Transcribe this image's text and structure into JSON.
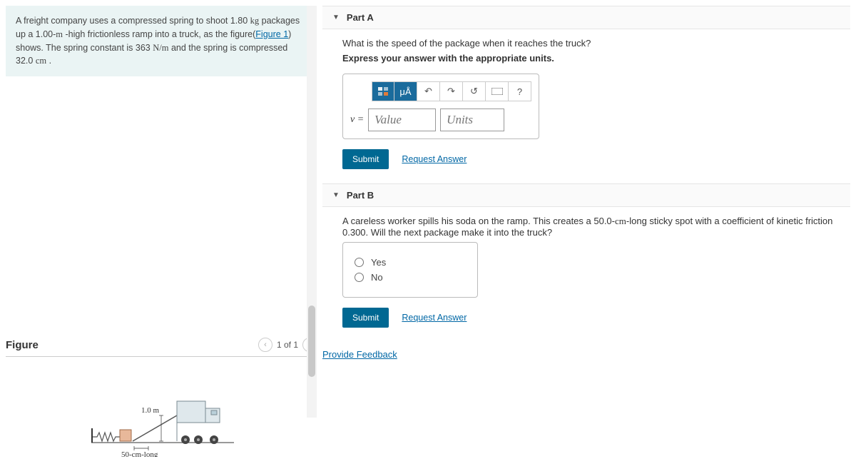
{
  "problem": {
    "text_before_link": "A freight company uses a compressed spring to shoot 1.80 ",
    "unit1": "kg",
    "text2": " packages up a 1.00-",
    "unit2": "m",
    "text3": " -high frictionless ramp into a truck, as the figure(",
    "figure_link": "Figure 1",
    "text4": ") shows. The spring constant is 363 ",
    "unit3": "N/m",
    "text5": " and the spring is compressed 32.0 ",
    "unit4": "cm",
    "text6": " ."
  },
  "figure": {
    "title": "Figure",
    "nav_label": "1 of 1",
    "dim_label": "1.0 m",
    "sticky_label": "50-cm-long"
  },
  "partA": {
    "title": "Part A",
    "question": "What is the speed of the package when it reaches the truck?",
    "instruction": "Express your answer with the appropriate units.",
    "var_label": "v =",
    "value_placeholder": "Value",
    "units_placeholder": "Units",
    "submit": "Submit",
    "request": "Request Answer",
    "tool_mu": "μÅ",
    "tool_help": "?"
  },
  "partB": {
    "title": "Part B",
    "question_before": "A careless worker spills his soda on the ramp. This creates a 50.0-",
    "question_unit": "cm",
    "question_after": "-long sticky spot with a coefficient of kinetic friction 0.300. Will the next package make it into the truck?",
    "option_yes": "Yes",
    "option_no": "No",
    "submit": "Submit",
    "request": "Request Answer"
  },
  "feedback_link": "Provide Feedback"
}
